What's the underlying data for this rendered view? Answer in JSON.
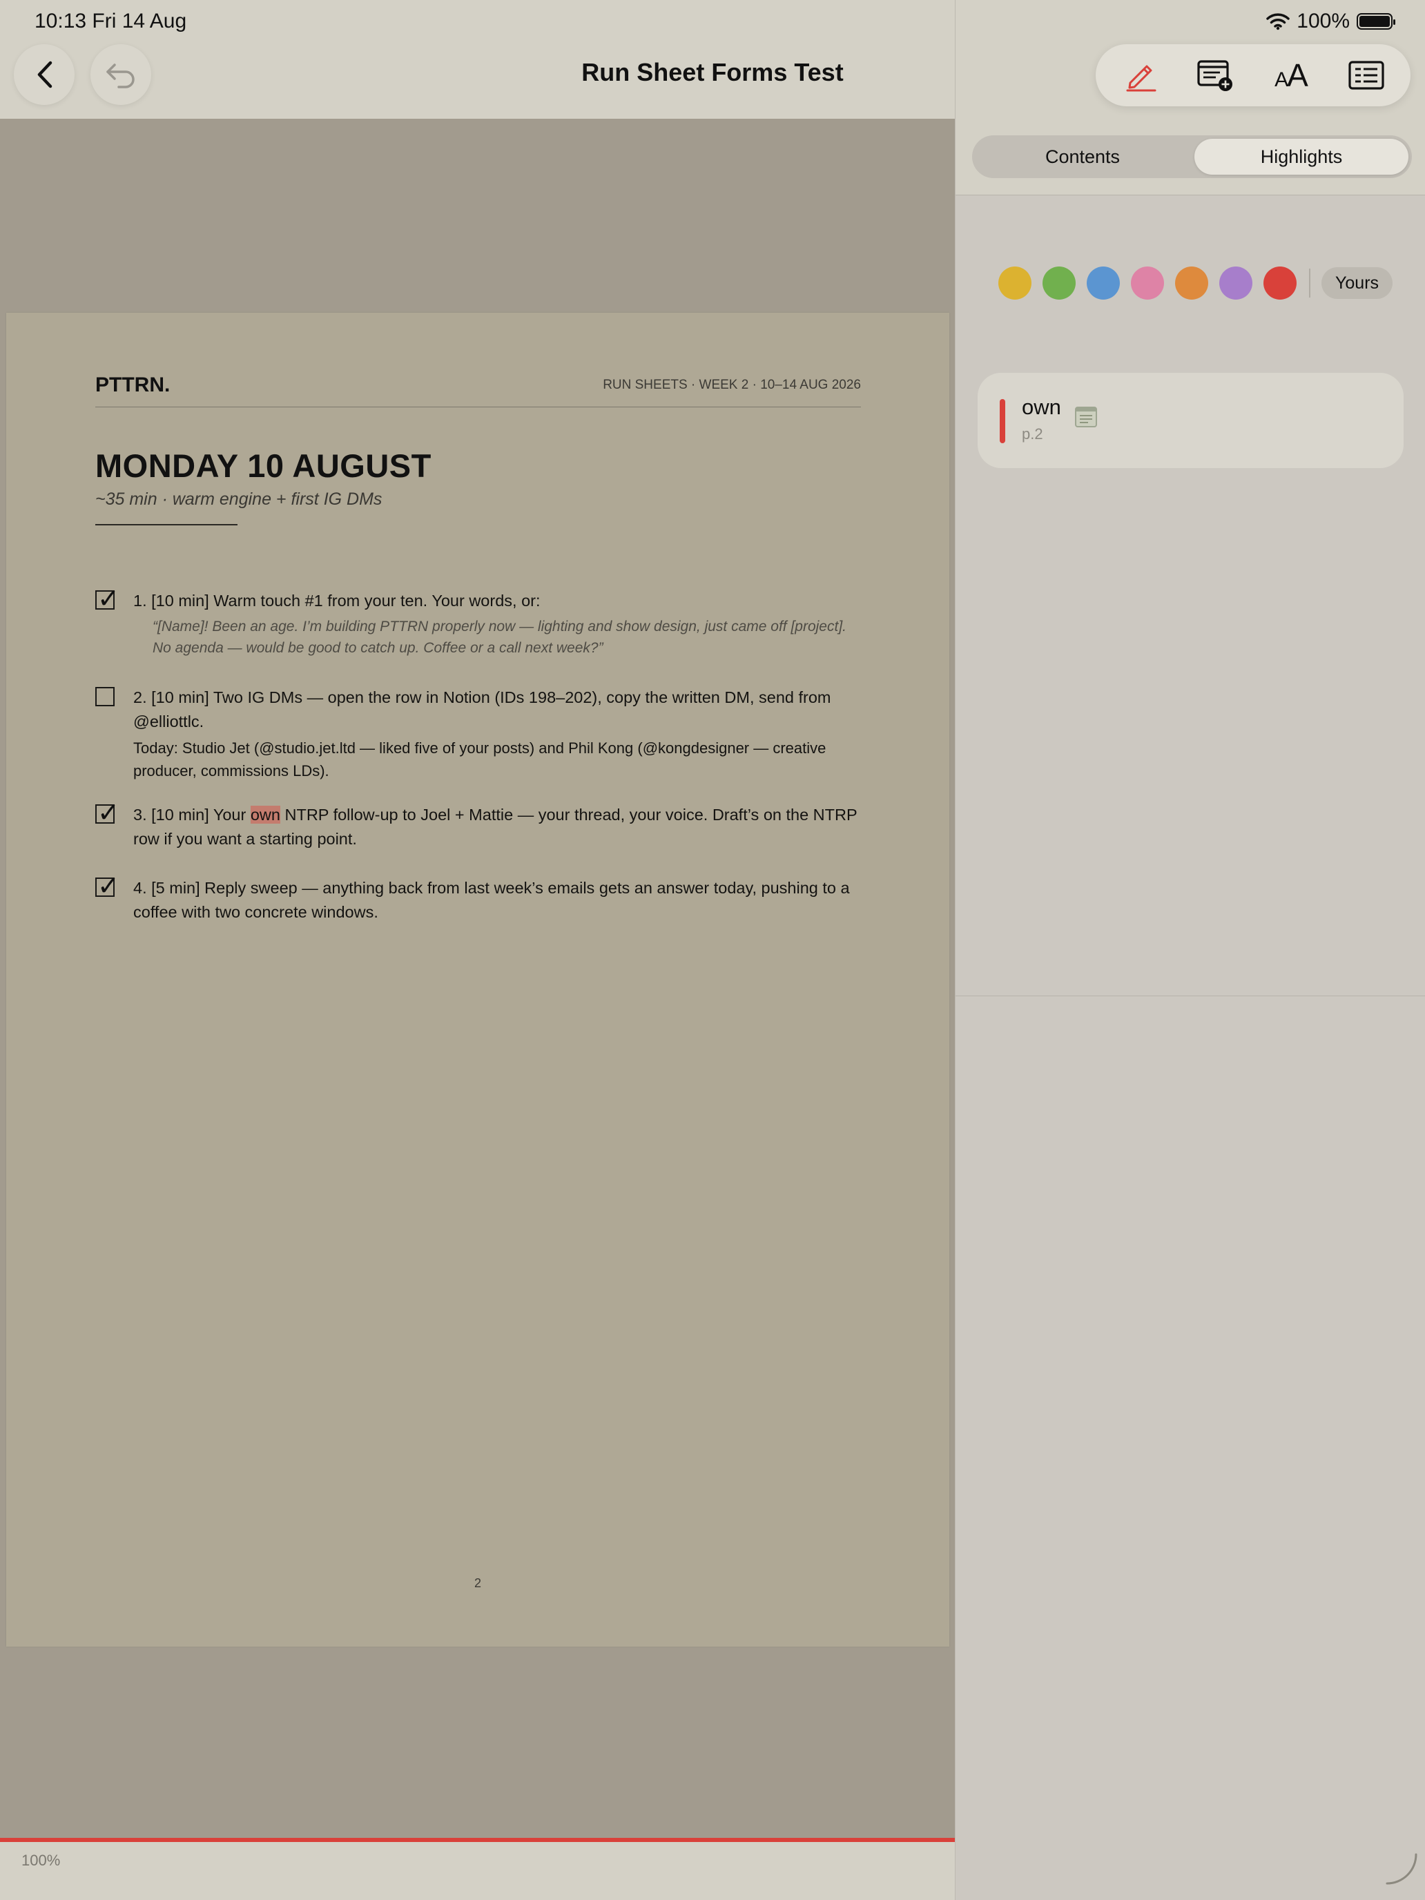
{
  "status": {
    "time_date": "10:13  Fri 14 Aug",
    "battery": "100%"
  },
  "header": {
    "title": "Run Sheet Forms Test"
  },
  "icons": {
    "back": "chevron-left-icon",
    "undo": "undo-icon",
    "highlighter": "pencil-icon",
    "add_note": "add-note-icon",
    "text_size": "text-size-icon",
    "outline": "outline-list-icon"
  },
  "toolbar": {
    "text_size_label_small": "A",
    "text_size_label_large": "A"
  },
  "document": {
    "brand": "PTTRN.",
    "running_head": "RUN SHEETS · WEEK 2 · 10–14 AUG 2026",
    "heading": "MONDAY 10 AUGUST",
    "subheading": "~35 min · warm engine + first IG DMs",
    "tasks": [
      {
        "checked": true,
        "text": "1. [10 min] Warm touch #1 from your ten. Your words, or:",
        "quote": "“[Name]! Been an age. I’m building PTTRN properly now — lighting and show design, just came off [project]. No agenda — would be good to catch up. Coffee or a call next week?”"
      },
      {
        "checked": false,
        "text": "2. [10 min] Two IG DMs — open the row in Notion (IDs 198–202), copy the written DM, send from @elliottlc.",
        "detail": "Today: Studio Jet (@studio.jet.ltd — liked five of your posts) and Phil Kong (@kongdesigner — creative producer, commissions LDs)."
      },
      {
        "checked": true,
        "text_before": "3. [10 min] Your ",
        "highlight": "own",
        "text_after": " NTRP follow-up to Joel + Mattie — your thread, your voice. Draft’s on the NTRP row if you want a starting point."
      },
      {
        "checked": true,
        "text": "4. [5 min] Reply sweep — anything back from last week’s emails gets an answer today, pushing to a coffee with two concrete windows."
      }
    ],
    "page_number": "2"
  },
  "reader": {
    "zoom": "100%",
    "progress": 1.0,
    "progress_color": "#d9413a"
  },
  "sidebar": {
    "tabs": [
      {
        "label": "Contents",
        "active": false
      },
      {
        "label": "Highlights",
        "active": true
      }
    ],
    "colors": [
      "#dcb230",
      "#71b04e",
      "#5b95d1",
      "#de83a6",
      "#de8a3d",
      "#a77ecb",
      "#d9413a"
    ],
    "filter_chip": "Yours",
    "highlights": [
      {
        "word": "own",
        "page": "p.2",
        "color": "#d9413a"
      }
    ]
  }
}
